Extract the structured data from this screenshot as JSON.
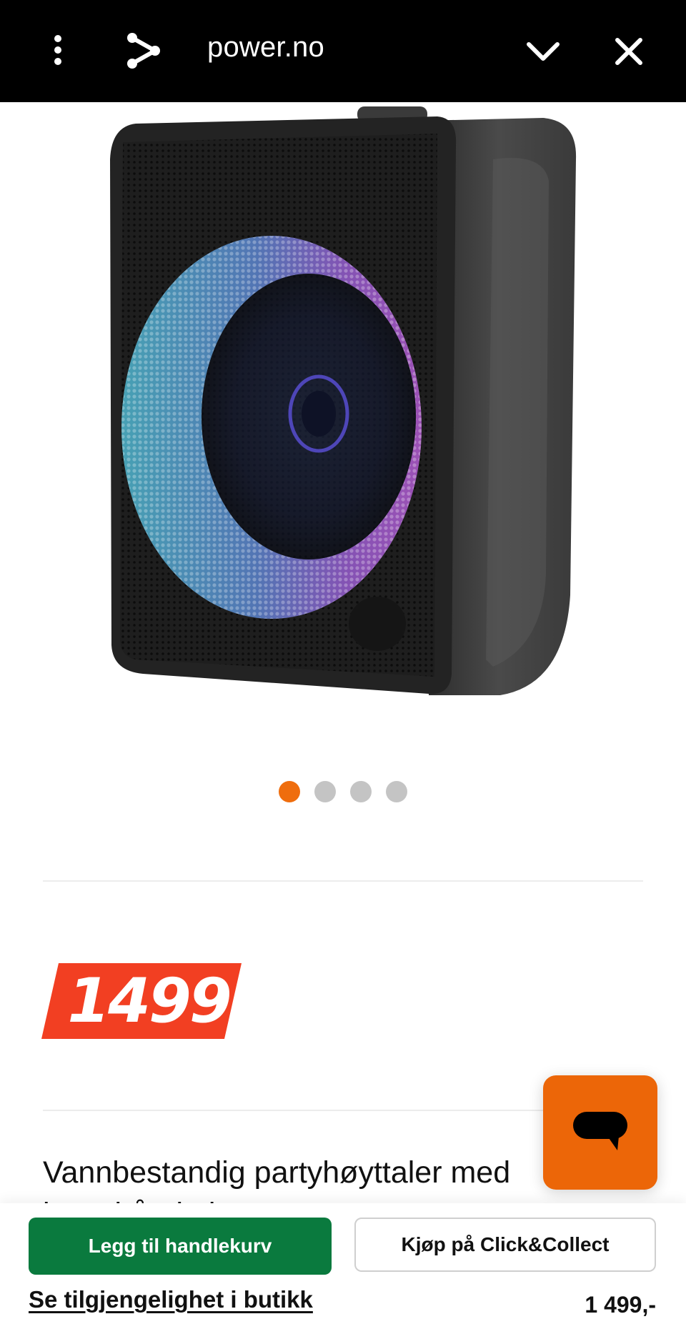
{
  "header": {
    "domain": "power.no",
    "icons": [
      "more-vertical-icon",
      "share-icon",
      "chevron-down-icon",
      "close-icon"
    ]
  },
  "gallery": {
    "image_alt": "Party speaker with RGB lights",
    "slide_count": 4,
    "active_slide": 1
  },
  "price_badge": {
    "value": "1499",
    "color": "#f23f22"
  },
  "product": {
    "title": "Vannbestandig partyhøyttaler med bærehåndtak"
  },
  "bottom_bar": {
    "add_to_cart_label": "Legg til handlekurv",
    "click_collect_label": "Kjøp på Click&Collect",
    "availability_link": "Se tilgjengelighet i butikk",
    "price": "1 499,-"
  },
  "colors": {
    "accent_orange": "#ec6608",
    "cart_green": "#0a7a3e",
    "price_red": "#f23f22"
  }
}
